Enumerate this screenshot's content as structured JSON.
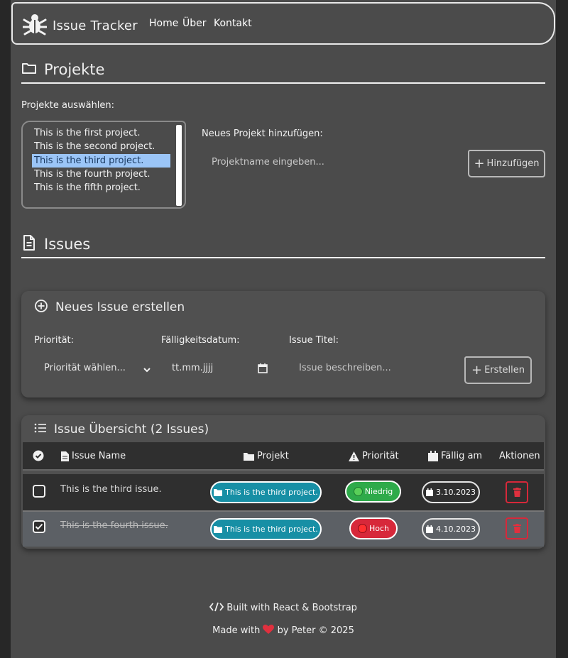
{
  "navbar": {
    "brand": "Issue Tracker",
    "links": [
      "Home",
      "Über",
      "Kontakt"
    ]
  },
  "projects": {
    "title": "Projekte",
    "select_label": "Projekte auswählen:",
    "items": [
      "This is the first project.",
      "This is the second project.",
      "This is the third project.",
      "This is the fourth project.",
      "This is the fifth project."
    ],
    "selected_index": 2,
    "add_label": "Neues Projekt hinzufügen:",
    "add_placeholder": "Projektname eingeben...",
    "add_button": "Hinzufügen"
  },
  "issues": {
    "title": "Issues",
    "create": {
      "title": "Neues Issue erstellen",
      "priority_label": "Priorität:",
      "priority_placeholder": "Priorität wählen...",
      "due_label": "Fälligkeitsdatum:",
      "due_placeholder": "tt.mm.jjjj",
      "title_label": "Issue Titel:",
      "title_placeholder": "Issue beschreiben...",
      "create_button": "Erstellen"
    },
    "overview": {
      "title": "Issue Übersicht (2 Issues)",
      "columns": [
        "Issue Name",
        "Projekt",
        "Priorität",
        "Fällig am",
        "Aktionen"
      ],
      "rows": [
        {
          "name": "This is the third issue.",
          "project": "This is the third project.",
          "priority": "Niedrig",
          "due": "3.10.2023",
          "done": false
        },
        {
          "name": "This is the fourth issue.",
          "project": "This is the third project.",
          "priority": "Hoch",
          "due": "4.10.2023",
          "done": true
        }
      ]
    }
  },
  "footer": {
    "built_with": "Built with React & Bootstrap",
    "made_with_prefix": "Made with",
    "made_with_suffix": "by Peter © 2025"
  },
  "colors": {
    "page_bg": "#4b4b4b",
    "outer_bg": "#272727",
    "selection": "#9bc5f7",
    "project_badge": "#178fa5",
    "priority_low": "#2eaa4a",
    "priority_high": "#d7283a",
    "heart": "#e0303e"
  }
}
